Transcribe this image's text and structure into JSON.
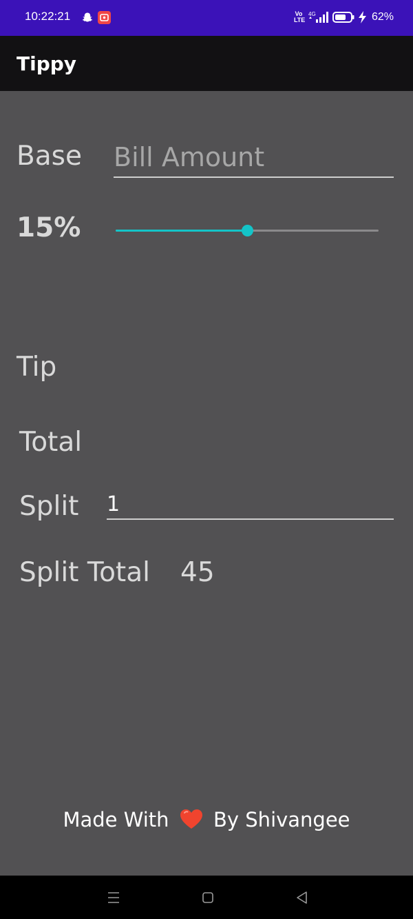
{
  "status_bar": {
    "time": "10:22:21",
    "network_label": "Vo LTE",
    "network_type": "4G",
    "battery_percent": "62%",
    "icons": [
      "snapchat-icon",
      "screen-record-icon",
      "volte-icon",
      "signal-icon",
      "battery-icon",
      "charging-icon"
    ],
    "background_color": "#3b12b8"
  },
  "app_bar": {
    "title": "Tippy",
    "background_color": "#121113"
  },
  "form": {
    "base_label": "Base",
    "bill_placeholder": "Bill Amount",
    "bill_value": "",
    "percent_label": "15%",
    "tip_slider": {
      "value": 15,
      "min": 0,
      "max": 30,
      "accent_color": "#14c4c8"
    },
    "tip_label": "Tip",
    "total_label": "Total",
    "split_label": "Split",
    "split_value": "1",
    "split_total_label": "Split Total",
    "split_total_value": "45"
  },
  "footer": {
    "prefix": "Made With",
    "icon": "heart-icon",
    "suffix": "By Shivangee"
  },
  "nav_bar": {
    "buttons": [
      "menu-icon",
      "home-icon",
      "back-icon"
    ]
  }
}
